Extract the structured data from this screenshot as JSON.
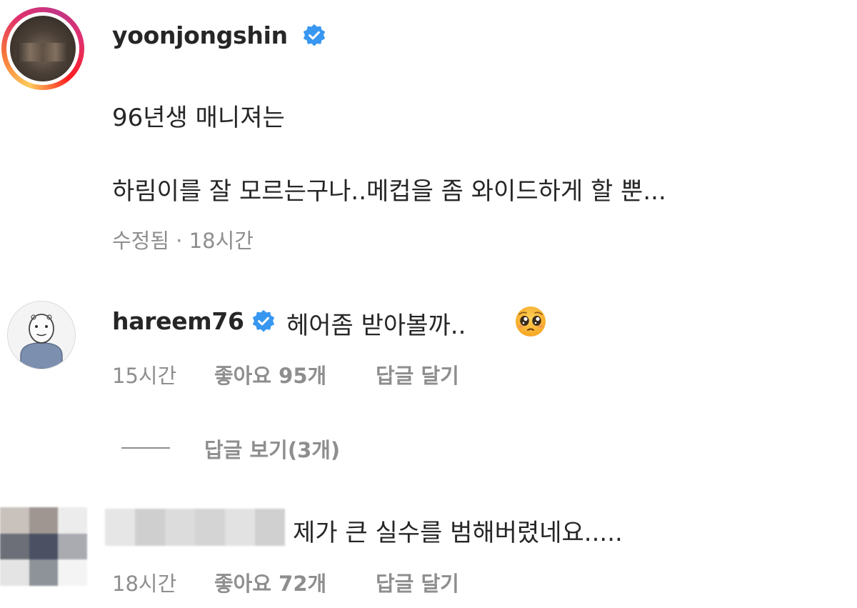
{
  "post": {
    "username": "yoonjongshin",
    "verified": true,
    "line1": "96년생 매니져는",
    "line2": "하림이를 잘 모르는구나..메컵을 좀 와이드하게 할 뿐...",
    "edited": "수정됨",
    "separator": "·",
    "time": "18시간"
  },
  "comments": [
    {
      "username": "hareem76",
      "verified": true,
      "text": "헤어좀 받아볼까..",
      "emoji": "pleading-face-emoji",
      "time": "15시간",
      "likes": "좋아요 95개",
      "reply": "답글 달기",
      "view_replies": "답글 보기(3개)"
    },
    {
      "username_hidden": true,
      "text": "제가 큰 실수를 범해버렸네요.....",
      "time": "18시간",
      "likes": "좋아요 72개",
      "reply": "답글 달기"
    }
  ],
  "colors": {
    "text": "#262626",
    "meta": "#8e8e8e",
    "verified": "#3897f0",
    "story_ring": [
      "#fdcb5c",
      "#f77737",
      "#e1306c",
      "#c13584"
    ]
  }
}
